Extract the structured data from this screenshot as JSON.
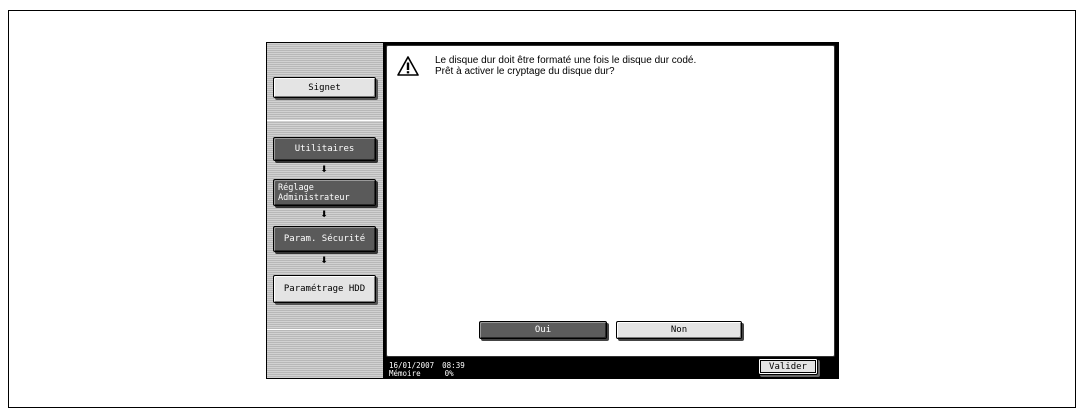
{
  "sidebar": {
    "signet_label": "Signet",
    "breadcrumb": [
      {
        "label": "Utilitaires"
      },
      {
        "label": "Réglage\nAdministrateur"
      },
      {
        "label": "Param. Sécurité"
      },
      {
        "label": "Paramétrage HDD"
      }
    ],
    "arrow_icon": "down-arrow-icon"
  },
  "dialog": {
    "icon": "warning-icon",
    "message_line1": "Le disque dur doit être formaté une fois le disque dur codé.",
    "message_line2": "Prêt à activer le cryptage du disque dur?",
    "yes_label": "Oui",
    "no_label": "Non",
    "selected": "Oui"
  },
  "status_bar": {
    "date": "16/01/2007",
    "time": "08:39",
    "memory_label": "Mémoire",
    "memory_value": "0%"
  },
  "footer": {
    "validate_label": "Valider"
  }
}
